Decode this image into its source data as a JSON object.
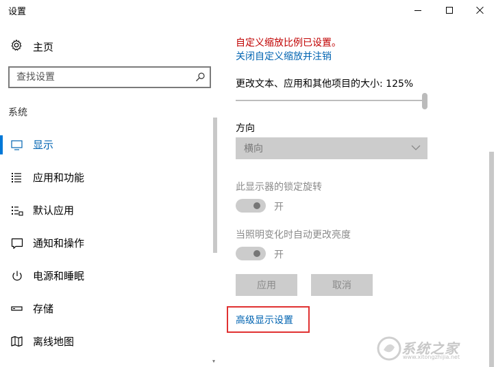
{
  "window": {
    "title": "设置"
  },
  "sidebar": {
    "home_label": "主页",
    "search_placeholder": "查找设置",
    "section_label": "系统",
    "items": [
      {
        "label": "显示",
        "icon": "monitor-icon",
        "active": true
      },
      {
        "label": "应用和功能",
        "icon": "list-icon",
        "active": false
      },
      {
        "label": "默认应用",
        "icon": "default-apps-icon",
        "active": false
      },
      {
        "label": "通知和操作",
        "icon": "notification-icon",
        "active": false
      },
      {
        "label": "电源和睡眠",
        "icon": "power-icon",
        "active": false
      },
      {
        "label": "存储",
        "icon": "storage-icon",
        "active": false
      },
      {
        "label": "离线地图",
        "icon": "map-icon",
        "active": false
      }
    ]
  },
  "main": {
    "custom_scale_warning": "自定义缩放比例已设置。",
    "custom_scale_link": "关闭自定义缩放并注销",
    "scale_label": "更改文本、应用和其他项目的大小: 125%",
    "scale_value_fraction": 1.0,
    "orientation_label": "方向",
    "orientation_value": "横向",
    "rotation_lock_label": "此显示器的锁定旋转",
    "rotation_lock_state": "开",
    "auto_brightness_label": "当照明变化时自动更改亮度",
    "auto_brightness_state": "开",
    "apply_button": "应用",
    "cancel_button": "取消",
    "advanced_link": "高级显示设置"
  },
  "watermark": {
    "text": "系统之家",
    "url": "www.xitongzhijia.net"
  },
  "colors": {
    "accent": "#0078d7",
    "link": "#0063b1",
    "warning": "#c00000",
    "highlight_box": "#e03030",
    "disabled_bg": "#cccccc"
  }
}
